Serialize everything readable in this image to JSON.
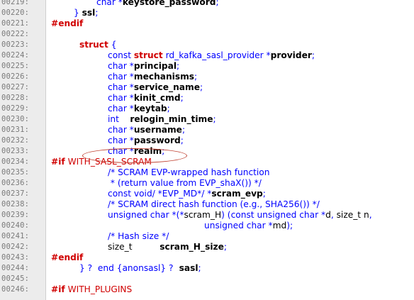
{
  "lines": [
    {
      "num": "00219:",
      "indent": 64,
      "tokens": [
        {
          "t": "char",
          "c": "kw"
        },
        {
          "t": " *",
          "c": "pun"
        },
        {
          "t": "keystore_password",
          "c": "idb"
        },
        {
          "t": ";",
          "c": "pun"
        }
      ]
    },
    {
      "num": "00220:",
      "indent": 32,
      "tokens": [
        {
          "t": "} ",
          "c": "pun"
        },
        {
          "t": "ssl",
          "c": "idb"
        },
        {
          "t": ";",
          "c": "pun"
        }
      ]
    },
    {
      "num": "00221:",
      "indent": 0,
      "tokens": [
        {
          "t": "#endif",
          "c": "ppb"
        }
      ]
    },
    {
      "num": "00222:",
      "indent": 0,
      "tokens": []
    },
    {
      "num": "00223:",
      "indent": 40,
      "tokens": [
        {
          "t": "struct",
          "c": "ppb"
        },
        {
          "t": " {",
          "c": "pun"
        }
      ]
    },
    {
      "num": "00224:",
      "indent": 80,
      "tokens": [
        {
          "t": "const ",
          "c": "kw"
        },
        {
          "t": "struct",
          "c": "ppb"
        },
        {
          "t": " rd_kafka_sasl_provider",
          "c": "kw"
        },
        {
          "t": " *",
          "c": "pun"
        },
        {
          "t": "provider",
          "c": "idb"
        },
        {
          "t": ";",
          "c": "pun"
        }
      ]
    },
    {
      "num": "00225:",
      "indent": 80,
      "tokens": [
        {
          "t": "char",
          "c": "kw"
        },
        {
          "t": " *",
          "c": "pun"
        },
        {
          "t": "principal",
          "c": "idb"
        },
        {
          "t": ";",
          "c": "pun"
        }
      ]
    },
    {
      "num": "00226:",
      "indent": 80,
      "tokens": [
        {
          "t": "char",
          "c": "kw"
        },
        {
          "t": " *",
          "c": "pun"
        },
        {
          "t": "mechanisms",
          "c": "idb"
        },
        {
          "t": ";",
          "c": "pun"
        }
      ]
    },
    {
      "num": "00227:",
      "indent": 80,
      "tokens": [
        {
          "t": "char",
          "c": "kw"
        },
        {
          "t": " *",
          "c": "pun"
        },
        {
          "t": "service_name",
          "c": "idb"
        },
        {
          "t": ";",
          "c": "pun"
        }
      ]
    },
    {
      "num": "00228:",
      "indent": 80,
      "tokens": [
        {
          "t": "char",
          "c": "kw"
        },
        {
          "t": " *",
          "c": "pun"
        },
        {
          "t": "kinit_cmd",
          "c": "idb"
        },
        {
          "t": ";",
          "c": "pun"
        }
      ]
    },
    {
      "num": "00229:",
      "indent": 80,
      "tokens": [
        {
          "t": "char",
          "c": "kw"
        },
        {
          "t": " *",
          "c": "pun"
        },
        {
          "t": "keytab",
          "c": "idb"
        },
        {
          "t": ";",
          "c": "pun"
        }
      ]
    },
    {
      "num": "00230:",
      "indent": 80,
      "tokens": [
        {
          "t": "int",
          "c": "kw"
        },
        {
          "t": "    ",
          "c": "pun"
        },
        {
          "t": "relogin_min_time",
          "c": "idb"
        },
        {
          "t": ";",
          "c": "pun"
        }
      ]
    },
    {
      "num": "00231:",
      "indent": 80,
      "tokens": [
        {
          "t": "char",
          "c": "kw"
        },
        {
          "t": " *",
          "c": "pun"
        },
        {
          "t": "username",
          "c": "idb"
        },
        {
          "t": ";",
          "c": "pun"
        }
      ]
    },
    {
      "num": "00232:",
      "indent": 80,
      "tokens": [
        {
          "t": "char",
          "c": "kw"
        },
        {
          "t": " *",
          "c": "pun"
        },
        {
          "t": "password",
          "c": "idb"
        },
        {
          "t": ";",
          "c": "pun"
        }
      ]
    },
    {
      "num": "00233:",
      "indent": 80,
      "tokens": [
        {
          "t": "char",
          "c": "kw"
        },
        {
          "t": " *",
          "c": "pun"
        },
        {
          "t": "realm",
          "c": "idb"
        },
        {
          "t": ";",
          "c": "pun"
        }
      ]
    },
    {
      "num": "00234:",
      "indent": 0,
      "tokens": [
        {
          "t": "#if",
          "c": "ppb"
        },
        {
          "t": " WITH_SASL_SCRAM",
          "c": "pp"
        }
      ]
    },
    {
      "num": "00235:",
      "indent": 80,
      "tokens": [
        {
          "t": "/* SCRAM EVP-wrapped hash function",
          "c": "cm"
        }
      ]
    },
    {
      "num": "00236:",
      "indent": 80,
      "tokens": [
        {
          "t": " * (return value from EVP_shaX()) */",
          "c": "cm"
        }
      ]
    },
    {
      "num": "00237:",
      "indent": 80,
      "tokens": [
        {
          "t": "const void",
          "c": "kw"
        },
        {
          "t": "/ *",
          "c": "pun"
        },
        {
          "t": "EVP_MD",
          "c": "kw"
        },
        {
          "t": "*/ *",
          "c": "pun"
        },
        {
          "t": "scram_evp",
          "c": "idb"
        },
        {
          "t": ";",
          "c": "pun"
        }
      ]
    },
    {
      "num": "00238:",
      "indent": 80,
      "tokens": [
        {
          "t": "/* SCRAM direct hash function (e.g., SHA256()) */",
          "c": "cm"
        }
      ]
    },
    {
      "num": "00239:",
      "indent": 80,
      "tokens": [
        {
          "t": "unsigned char",
          "c": "kw"
        },
        {
          "t": " *(*",
          "c": "pun"
        },
        {
          "t": "scram_H",
          "c": "id"
        },
        {
          "t": ") (",
          "c": "pun"
        },
        {
          "t": "const unsigned char",
          "c": "kw"
        },
        {
          "t": " *",
          "c": "pun"
        },
        {
          "t": "d",
          "c": "id"
        },
        {
          "t": ", ",
          "c": "pun"
        },
        {
          "t": "size_t",
          "c": "id"
        },
        {
          "t": " n",
          "c": "id"
        },
        {
          "t": ",",
          "c": "pun"
        }
      ]
    },
    {
      "num": "00240:",
      "indent": 216,
      "tokens": [
        {
          "t": "unsigned char",
          "c": "kw"
        },
        {
          "t": " *",
          "c": "pun"
        },
        {
          "t": "md",
          "c": "id"
        },
        {
          "t": ");",
          "c": "pun"
        }
      ]
    },
    {
      "num": "00241:",
      "indent": 80,
      "tokens": [
        {
          "t": "/* Hash size */",
          "c": "cm"
        }
      ]
    },
    {
      "num": "00242:",
      "indent": 80,
      "tokens": [
        {
          "t": "size_t",
          "c": "id"
        },
        {
          "t": "          ",
          "c": "pun"
        },
        {
          "t": "scram_H_size",
          "c": "idb"
        },
        {
          "t": ";",
          "c": "pun"
        }
      ]
    },
    {
      "num": "00243:",
      "indent": 0,
      "tokens": [
        {
          "t": "#endif",
          "c": "ppb"
        }
      ]
    },
    {
      "num": "00244:",
      "indent": 40,
      "tokens": [
        {
          "t": "} ? ",
          "c": "pun"
        },
        {
          "t": " end {anonsasl} ? ",
          "c": "cm"
        },
        {
          "t": " sasl",
          "c": "idb"
        },
        {
          "t": ";",
          "c": "pun"
        }
      ]
    },
    {
      "num": "00245:",
      "indent": 0,
      "tokens": []
    },
    {
      "num": "00246:",
      "indent": 0,
      "tokens": [
        {
          "t": "#if",
          "c": "ppb"
        },
        {
          "t": " WITH_PLUGINS",
          "c": "pp"
        }
      ]
    }
  ],
  "highlight": {
    "line": "00233:",
    "color": "#c04030"
  }
}
